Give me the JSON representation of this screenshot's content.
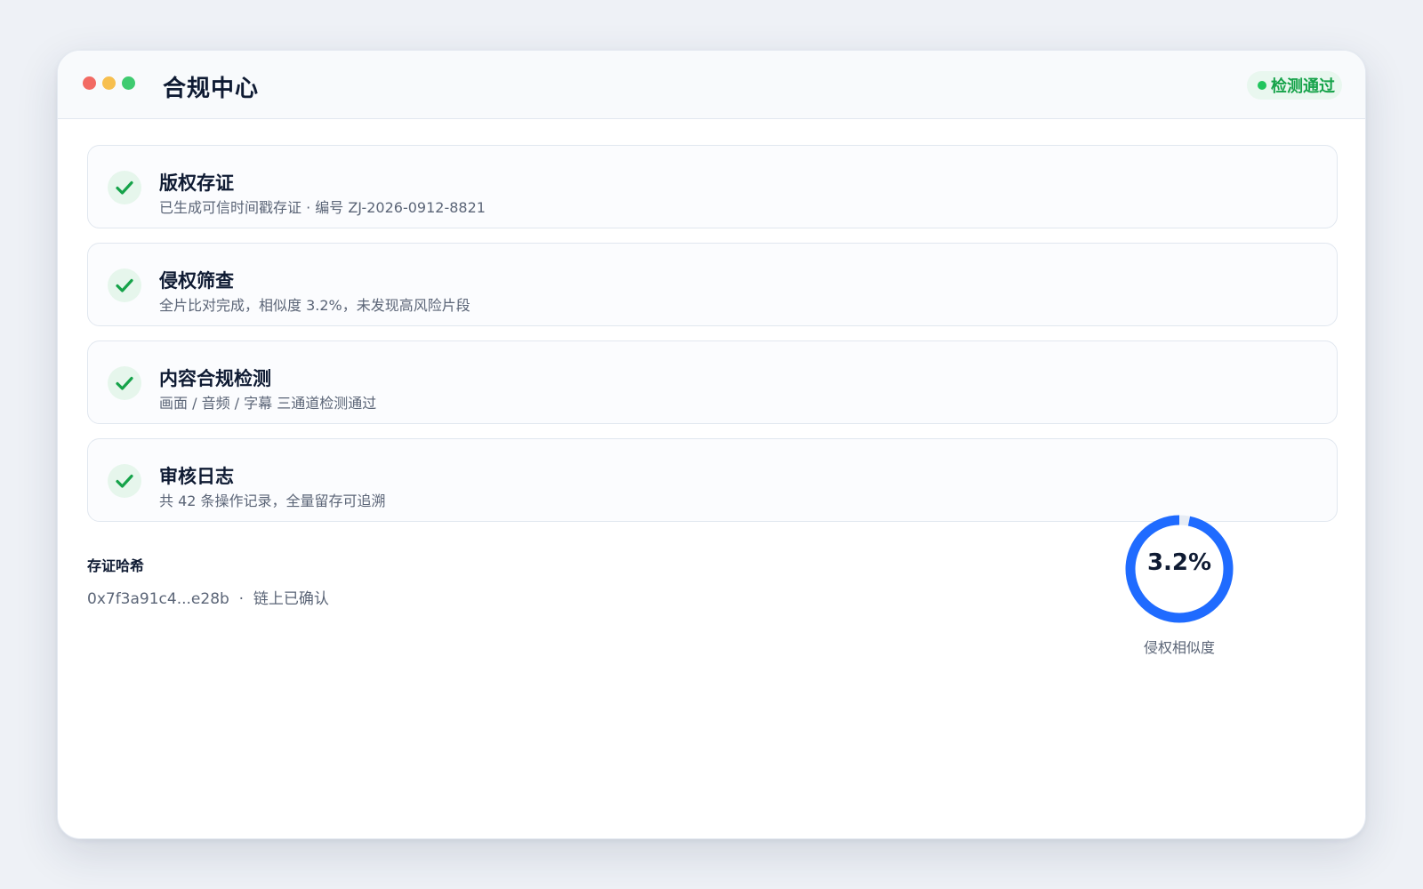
{
  "window": {
    "title": "合规中心",
    "status_badge": "检测通过"
  },
  "checks": [
    {
      "title": "版权存证",
      "desc": "已生成可信时间戳存证 · 编号 ZJ-2026-0912-8821",
      "status": "passed"
    },
    {
      "title": "侵权筛查",
      "desc": "全片比对完成，相似度 3.2%，未发现高风险片段",
      "status": "passed"
    },
    {
      "title": "内容合规检测",
      "desc": "画面 / 音频 / 字幕 三通道检测通过",
      "status": "passed"
    },
    {
      "title": "审核日志",
      "desc": "共 42 条操作记录，全量留存可追溯",
      "status": "passed"
    }
  ],
  "hash": {
    "label": "存证哈希",
    "value": "0x7f3a91c4...e28b  ·  链上已确认"
  },
  "gauge": {
    "value_text": "3.2%",
    "fraction": 0.968,
    "label": "侵权相似度"
  },
  "colors": {
    "accent_blue": "#1f6bff",
    "success_green": "#22c55e",
    "gauge_track": "#e6ecf5"
  },
  "icons": {
    "check": "check-icon"
  }
}
